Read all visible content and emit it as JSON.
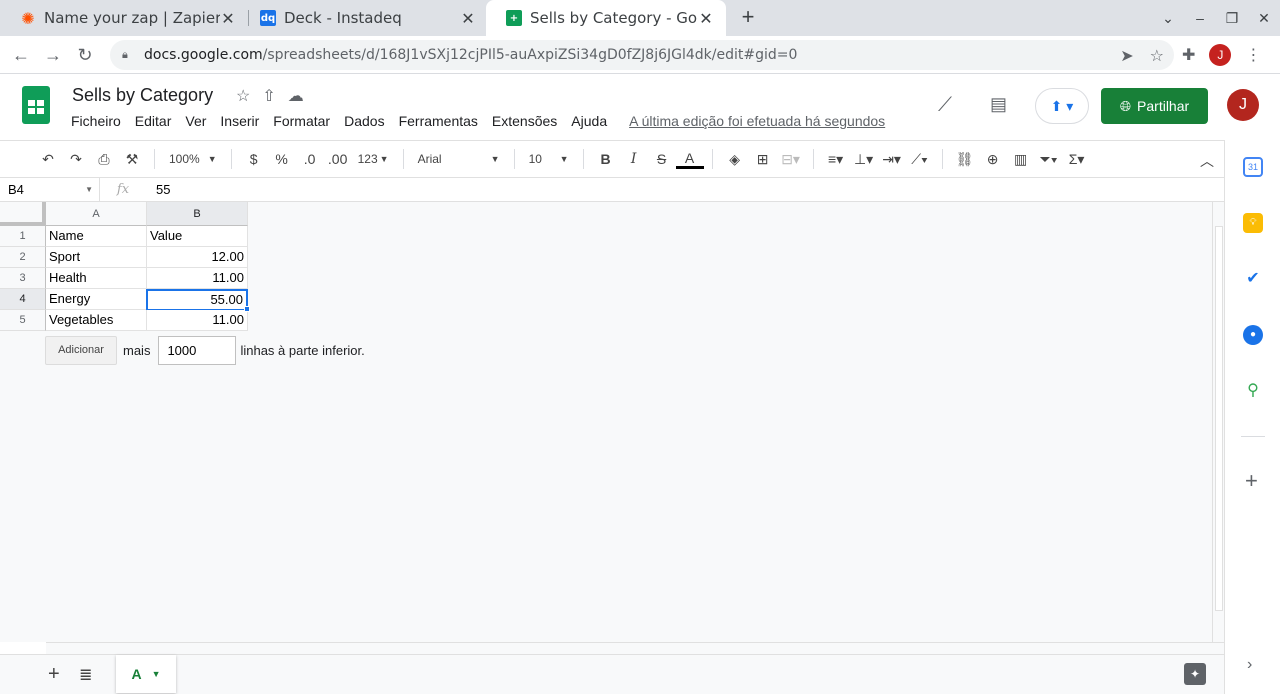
{
  "browser": {
    "tabs": [
      {
        "title": "Name your zap | Zapier",
        "favicon": "zapier-icon",
        "color": "#ff4f00"
      },
      {
        "title": "Deck - Instadeq",
        "favicon": "instadeq-icon",
        "color": "#1a73e8",
        "badge": "dq"
      },
      {
        "title": "Sells by Category - Google",
        "favicon": "sheets-icon",
        "color": "#0f9d58"
      }
    ],
    "url_host": "docs.google.com",
    "url_path": "/spreadsheets/d/168J1vSXj12cjPIl5-auAxpiZSi34gD0fZJ8j6JGl4dk/edit#gid=0",
    "profile_initial": "J"
  },
  "sheets": {
    "title": "Sells by Category",
    "menu": [
      "Ficheiro",
      "Editar",
      "Ver",
      "Inserir",
      "Formatar",
      "Dados",
      "Ferramentas",
      "Extensões",
      "Ajuda"
    ],
    "last_edit": "A última edição foi efetuada há segundos",
    "share_label": "Partilhar",
    "profile_initial": "J",
    "accent": "#188038"
  },
  "toolbar": {
    "zoom": "100%",
    "currency": "$",
    "percent": "%",
    "dec_less": ".0",
    "dec_more": ".00",
    "format_more": "123",
    "font": "Arial",
    "font_size": "10"
  },
  "formula": {
    "cell_ref": "B4",
    "fx": "fx",
    "value": "55"
  },
  "grid": {
    "columns": [
      "A",
      "B"
    ],
    "rows": [
      "1",
      "2",
      "3",
      "4",
      "5"
    ],
    "cells": [
      [
        "Name",
        "Value"
      ],
      [
        "Sport",
        "12.00"
      ],
      [
        "Health",
        "11.00"
      ],
      [
        "Energy",
        "55.00"
      ],
      [
        "Vegetables",
        "11.00"
      ]
    ],
    "selected": "B4"
  },
  "add_rows": {
    "button": "Adicionar",
    "mais": "mais",
    "count": "1000",
    "suffix": "linhas à parte inferior."
  },
  "sheet_tabs": {
    "active": "A"
  },
  "side_panel": {
    "calendar_label": "31"
  }
}
